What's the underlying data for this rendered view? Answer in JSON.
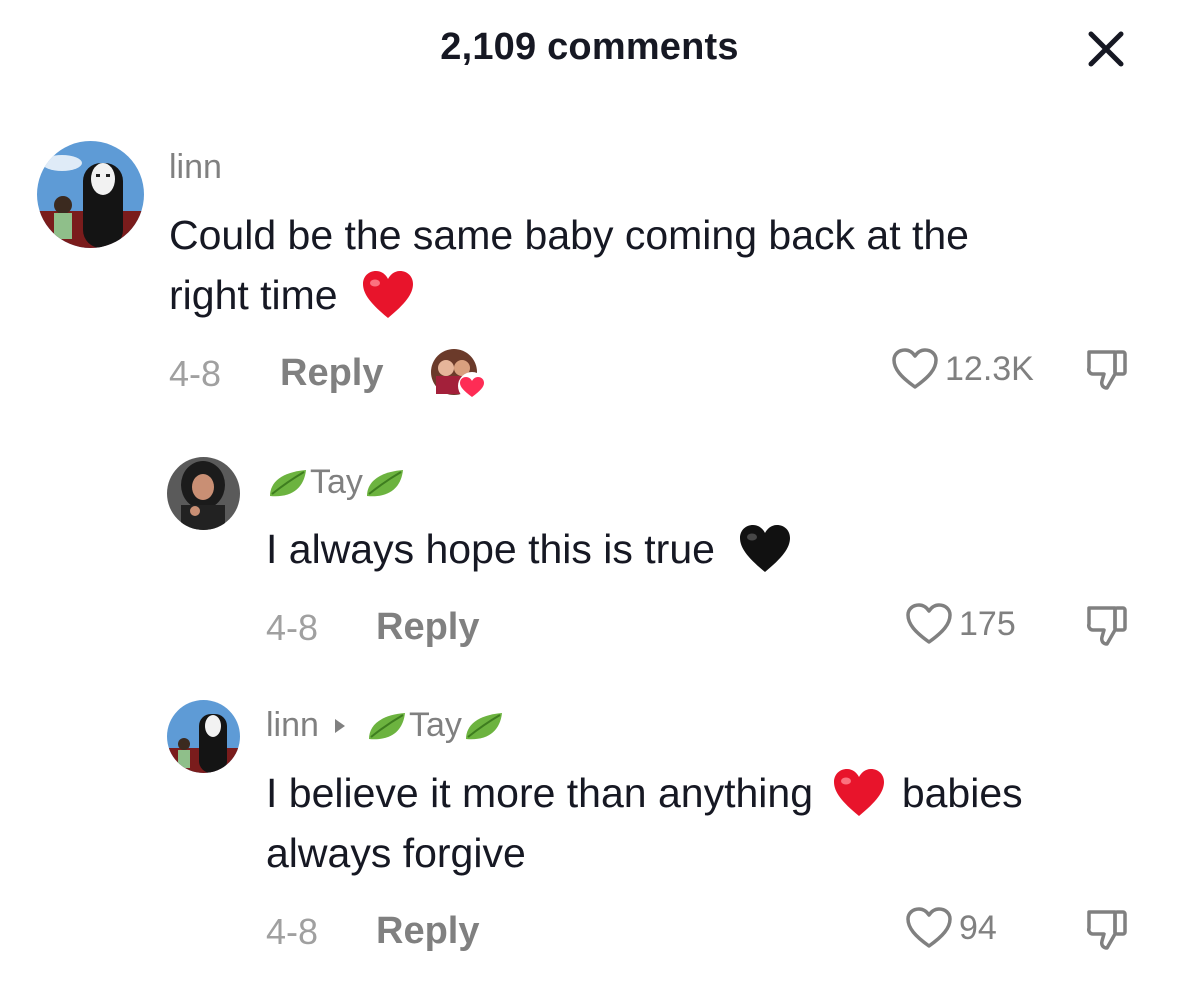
{
  "header": {
    "title": "2,109 comments"
  },
  "comments": [
    {
      "username": "linn",
      "text_line1": "Could be the same baby coming back at the",
      "text_line2": "right time",
      "date": "4-8",
      "reply_label": "Reply",
      "likes": "12.3K",
      "emoji": "red-heart"
    },
    {
      "username": "Tay",
      "text_line1": "I always hope this is true",
      "date": "4-8",
      "reply_label": "Reply",
      "likes": "175",
      "emoji": "black-heart"
    },
    {
      "username": "linn",
      "reply_to": "Tay",
      "text_line1a": "I believe it more than anything",
      "text_line1b": "babies",
      "text_line2": "always forgive",
      "date": "4-8",
      "reply_label": "Reply",
      "likes": "94",
      "emoji": "red-heart"
    }
  ],
  "colors": {
    "text": "#161823",
    "secondary": "#808080",
    "muted": "#a0a0a0",
    "heart_red": "#e8142b",
    "creator_like_heart": "#fe2c55",
    "leaf_green": "#6cb33f"
  }
}
